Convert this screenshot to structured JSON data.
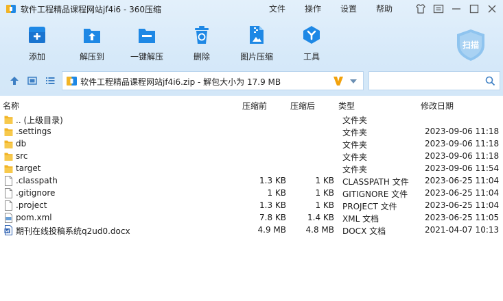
{
  "window": {
    "title": "软件工程精品课程网站jf4i6 - 360压缩",
    "menu": [
      "文件",
      "操作",
      "设置",
      "帮助"
    ]
  },
  "toolbar": {
    "buttons": [
      {
        "label": "添加",
        "icon": "add-icon"
      },
      {
        "label": "解压到",
        "icon": "extract-to-icon"
      },
      {
        "label": "一键解压",
        "icon": "one-click-extract-icon"
      },
      {
        "label": "删除",
        "icon": "trash-icon"
      },
      {
        "label": "图片压缩",
        "icon": "image-compress-icon"
      },
      {
        "label": "工具",
        "icon": "tools-icon"
      }
    ],
    "scan_label": "扫描"
  },
  "colors": {
    "accent": "#1e88e5",
    "folder": "#f2b425",
    "toolbar_bg": "#d6e9f9",
    "scan_badge": "#8fc4ef"
  },
  "address": {
    "path": "软件工程精品课程网站jf4i6.zip - 解包大小为 17.9 MB",
    "search_placeholder": ""
  },
  "columns": {
    "name": "名称",
    "packed": "压缩前",
    "unpacked": "压缩后",
    "type": "类型",
    "modified": "修改日期"
  },
  "files": [
    {
      "icon": "folder-icon",
      "name": ".. (上级目录)",
      "packed": "",
      "unpacked": "",
      "type": "文件夹",
      "modified": ""
    },
    {
      "icon": "folder-icon",
      "name": ".settings",
      "packed": "",
      "unpacked": "",
      "type": "文件夹",
      "modified": "2023-09-06 11:18"
    },
    {
      "icon": "folder-icon",
      "name": "db",
      "packed": "",
      "unpacked": "",
      "type": "文件夹",
      "modified": "2023-09-06 11:18"
    },
    {
      "icon": "folder-icon",
      "name": "src",
      "packed": "",
      "unpacked": "",
      "type": "文件夹",
      "modified": "2023-09-06 11:18"
    },
    {
      "icon": "folder-icon",
      "name": "target",
      "packed": "",
      "unpacked": "",
      "type": "文件夹",
      "modified": "2023-09-06 11:54"
    },
    {
      "icon": "file-icon",
      "name": ".classpath",
      "packed": "1.3 KB",
      "unpacked": "1 KB",
      "type": "CLASSPATH 文件",
      "modified": "2023-06-25 11:04"
    },
    {
      "icon": "file-icon",
      "name": ".gitignore",
      "packed": "1 KB",
      "unpacked": "1 KB",
      "type": "GITIGNORE 文件",
      "modified": "2023-06-25 11:04"
    },
    {
      "icon": "file-icon",
      "name": ".project",
      "packed": "1.3 KB",
      "unpacked": "1 KB",
      "type": "PROJECT 文件",
      "modified": "2023-06-25 11:04"
    },
    {
      "icon": "xml-file-icon",
      "name": "pom.xml",
      "packed": "7.8 KB",
      "unpacked": "1.4 KB",
      "type": "XML 文档",
      "modified": "2023-06-25 11:05"
    },
    {
      "icon": "docx-file-icon",
      "name": "期刊在线投稿系统q2ud0.docx",
      "packed": "4.9 MB",
      "unpacked": "4.8 MB",
      "type": "DOCX 文档",
      "modified": "2021-04-07 10:13"
    }
  ]
}
